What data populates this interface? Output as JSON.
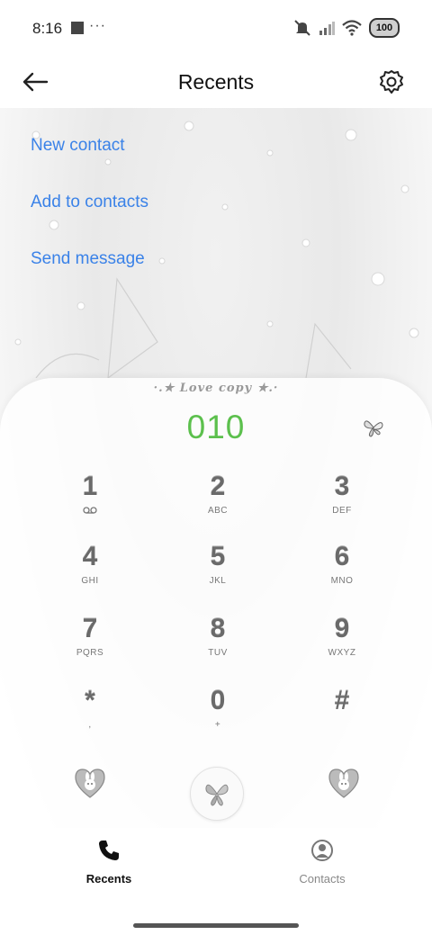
{
  "status_bar": {
    "time": "8:16",
    "more": "···",
    "battery": "100"
  },
  "header": {
    "title": "Recents"
  },
  "actions": [
    {
      "label": "New contact"
    },
    {
      "label": "Add to contacts"
    },
    {
      "label": "Send message"
    }
  ],
  "dialer": {
    "theme_caption": "·.★ Love copy ★.·",
    "number": "010",
    "keys": [
      {
        "digit": "1",
        "letters": "",
        "sub_icon": "voicemail-icon"
      },
      {
        "digit": "2",
        "letters": "ABC"
      },
      {
        "digit": "3",
        "letters": "DEF"
      },
      {
        "digit": "4",
        "letters": "GHI"
      },
      {
        "digit": "5",
        "letters": "JKL"
      },
      {
        "digit": "6",
        "letters": "MNO"
      },
      {
        "digit": "7",
        "letters": "PQRS"
      },
      {
        "digit": "8",
        "letters": "TUV"
      },
      {
        "digit": "9",
        "letters": "WXYZ"
      },
      {
        "digit": "*",
        "letters": ","
      },
      {
        "digit": "0",
        "letters": "+"
      },
      {
        "digit": "#",
        "letters": ""
      }
    ]
  },
  "bottom_nav": {
    "items": [
      {
        "label": "Recents",
        "icon": "phone-icon",
        "active": true
      },
      {
        "label": "Contacts",
        "icon": "contact-icon",
        "active": false
      }
    ]
  },
  "colors": {
    "accent_link": "#3a82e8",
    "dial_number": "#5cc04d",
    "active_nav": "#111111",
    "inactive_nav": "#888888"
  }
}
